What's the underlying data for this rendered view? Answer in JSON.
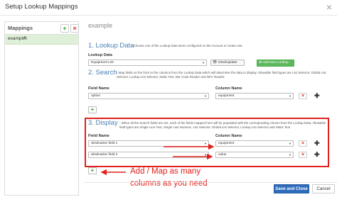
{
  "window": {
    "title": "Setup Lookup Mappings",
    "close_glyph": "×"
  },
  "sidebar": {
    "title": "Mappings",
    "add_label": "+",
    "delete_label": "×",
    "items": [
      {
        "label": "example"
      }
    ]
  },
  "main": {
    "heading": "example",
    "section1": {
      "title": "1. Lookup Data",
      "desc": "- Choose one of the Lookup Data items configured on the Account or create one.",
      "field_label": "Lookup Data",
      "selected": "Equipment List",
      "view_update_label": "View/Update",
      "add_new_label": "Add New Lookup"
    },
    "section2": {
      "title": "2. Search",
      "desc": "- Map fields on the form to the columns from the Lookup Data which will determine the data to display. Allowable field types are List Selector, Global List Selector, Lookup List Selector, Static Text, Bar Code Reader and NFC Reader.",
      "field_name_header": "Field Name",
      "column_name_header": "Column Name",
      "rows": [
        {
          "field": "option",
          "column": "equipment"
        }
      ]
    },
    "section3": {
      "title": "3. Display",
      "desc": "- When all the Search fields are set, each of the fields mapped here will be populated with the corresponding column from the Lookup Data. Allowable field types are Single Line Text, Single Line Numeric, List Selector, Global List Selector, Lookup List Selector and Static Text",
      "field_name_header": "Field Name",
      "column_name_header": "Column Name",
      "rows": [
        {
          "field": "destination field 1",
          "column": "equipment"
        },
        {
          "field": "destination field 2",
          "column": "value"
        }
      ]
    }
  },
  "annotation": {
    "line1": "Add / Map as many",
    "line2": "columns as you need",
    "color": "#e0211d"
  },
  "footer": {
    "save_label": "Save and Close",
    "cancel_label": "Cancel"
  },
  "colors": {
    "accent": "#4a7fb5",
    "green": "#5cb85c",
    "primary": "#2f6cbb",
    "danger": "#d9302c"
  }
}
